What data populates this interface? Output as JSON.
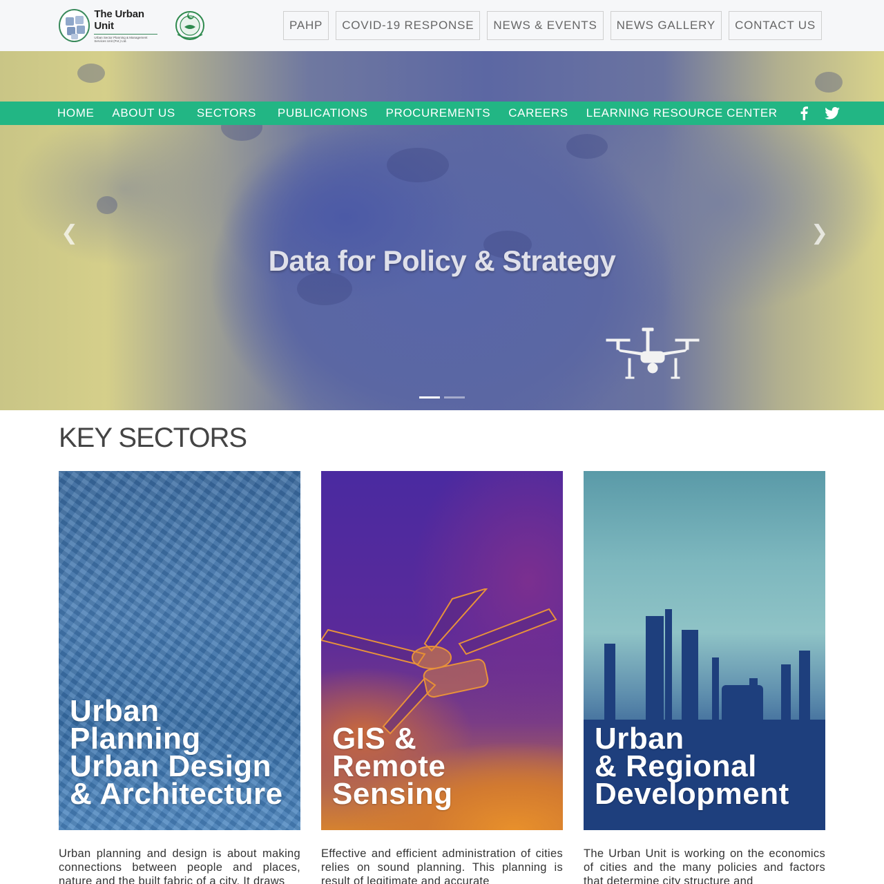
{
  "header": {
    "logo_title": "The Urban Unit",
    "logo_subtitle": "Urban Sector Planning & Management Services Unit (Pvt.) Ltd.",
    "top_links": [
      "PAHP",
      "COVID-19 RESPONSE",
      "NEWS & EVENTS",
      "NEWS GALLERY",
      "CONTACT US"
    ]
  },
  "nav": {
    "items": [
      "HOME",
      "ABOUT US",
      "SECTORS",
      "PUBLICATIONS",
      "PROCUREMENTS",
      "CAREERS",
      "LEARNING RESOURCE CENTER"
    ],
    "social": [
      "facebook-icon",
      "twitter-icon"
    ]
  },
  "hero": {
    "title": "Data for Policy & Strategy",
    "slides": 2,
    "active_slide": 1
  },
  "sectors": {
    "title": "KEY SECTORS",
    "cards": [
      {
        "heading_lines": [
          "Urban",
          "Planning",
          "Urban Design",
          "& Architecture"
        ],
        "description": "Urban planning and design is about making connections between people and places, nature and the built fabric of a city. It draws"
      },
      {
        "heading_lines": [
          "GIS &",
          "Remote",
          "Sensing"
        ],
        "description": "Effective and efficient administration of cities relies on sound planning. This planning is result of legitimate and accurate"
      },
      {
        "heading_lines": [
          "Urban",
          "& Regional",
          "Development"
        ],
        "description": "The Urban Unit is working on the economics of cities and the many policies and factors that determine city structure and"
      }
    ]
  },
  "colors": {
    "nav_green": "#22b684",
    "topbar_bg": "#f6f7f9"
  }
}
